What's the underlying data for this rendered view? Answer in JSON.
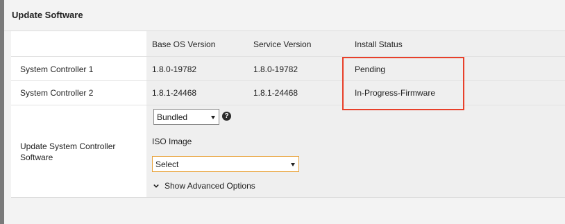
{
  "panel": {
    "title": "Update Software"
  },
  "table": {
    "headers": [
      "Base OS Version",
      "Service Version",
      "Install Status"
    ],
    "rows": [
      {
        "name": "System Controller 1",
        "base_os": "1.8.0-19782",
        "service": "1.8.0-19782",
        "status": "Pending"
      },
      {
        "name": "System Controller 2",
        "base_os": "1.8.1-24468",
        "service": "1.8.1-24468",
        "status": "In-Progress-Firmware"
      }
    ]
  },
  "update": {
    "label": "Update System Controller Software",
    "source_select": {
      "value": "Bundled"
    },
    "help_glyph": "?",
    "iso_label": "ISO Image",
    "iso_select": {
      "value": "Select"
    },
    "advanced_label": "Show Advanced Options"
  },
  "colors": {
    "highlight": "#e8402a",
    "iso_select_border": "#e8a33b"
  },
  "icons": {
    "help": "help-icon",
    "advanced": "chevron-down-icon",
    "select_caret": "caret-down-icon"
  }
}
